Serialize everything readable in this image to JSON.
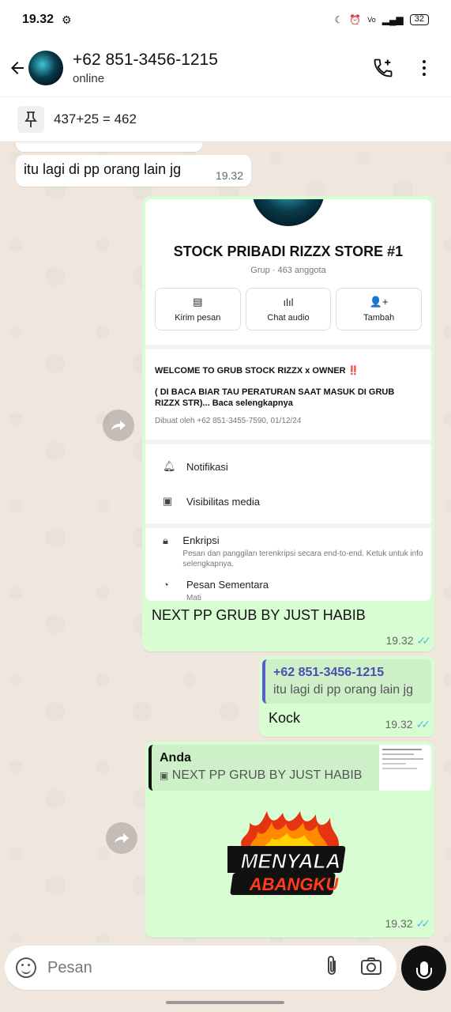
{
  "status": {
    "time": "19.32",
    "battery": "32"
  },
  "header": {
    "name": "+62 851-3456-1215",
    "status": "online"
  },
  "pinned": {
    "text": "437+25 = 462"
  },
  "messages": {
    "m1": {
      "text": "itu lagi di pp orang lain jg",
      "time": "19.32"
    },
    "m2": {
      "caption": "NEXT PP GRUB BY JUST HABIB",
      "time": "19.32",
      "shot": {
        "title": "STOCK PRIBADI RIZZX STORE #1",
        "sub": "Grup · 463 anggota",
        "btn1": "Kirim pesan",
        "btn2": "Chat audio",
        "btn3": "Tambah",
        "desc1": "WELCOME TO GRUB STOCK RIZZX x OWNER ‼️",
        "desc2a": "( DI BACA BIAR TAU PERATURAN SAAT MASUK DI GRUB RIZZX STR)...",
        "desc2b": "Baca selengkapnya",
        "desc3": "Dibuat oleh +62 851-3455-7590, 01/12/24",
        "row1": "Notifikasi",
        "row2": "Visibilitas media",
        "row3": "Enkripsi",
        "row3sub": "Pesan dan panggilan terenkripsi secara end-to-end. Ketuk untuk info selengkapnya.",
        "row4": "Pesan Sementara",
        "row4sub": "Mati"
      }
    },
    "m3": {
      "quote_name": "+62 851-3456-1215",
      "quote_text": "itu lagi di pp orang lain jg",
      "text": "Kock",
      "time": "19.32"
    },
    "m4": {
      "quote_name": "Anda",
      "quote_text": "NEXT PP GRUB BY JUST HABIB",
      "sticker_line1": "MENYALA",
      "sticker_line2": "ABANGKU",
      "time": "19.32"
    }
  },
  "input": {
    "placeholder": "Pesan"
  },
  "colors": {
    "bubble_out": "#d9fdd3",
    "read_ticks": "#53bdeb",
    "quote_contact": "#5b5fc7",
    "quote_self": "#111111"
  }
}
